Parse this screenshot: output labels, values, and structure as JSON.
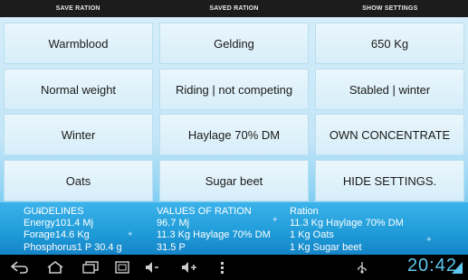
{
  "action_bar": {
    "save_ration": "SAVE RATION",
    "saved_ration": "SAVED RATION",
    "show_settings": "SHOW SETTINGS"
  },
  "grid": [
    [
      "Warmblood",
      "Gelding",
      "650 Kg"
    ],
    [
      "Normal weight",
      "Riding | not competing",
      "Stabled | winter"
    ],
    [
      "Winter",
      "Haylage 70% DM",
      "OWN CONCENTRATE"
    ],
    [
      "Oats",
      "Sugar beet",
      "HIDE SETTINGS."
    ]
  ],
  "info": {
    "guidelines": [
      "GUIDELINES",
      "Energy101.4 Mj",
      "Forage14.6 Kg",
      "Phosphorus1 P 30.4 g"
    ],
    "values": [
      "VALUES OF RATION",
      "96.7 Mj",
      "11.3 Kg Haylage 70% DM",
      "31.5 P"
    ],
    "ration": [
      "Ration",
      "11.3 Kg Haylage 70% DM",
      "1 Kg Oats",
      "1 Kg Sugar beet"
    ]
  },
  "system_bar": {
    "clock": "20:42",
    "icons": [
      "back-icon",
      "home-icon",
      "recent-apps-icon",
      "screenshot-icon",
      "volume-down-icon",
      "volume-up-icon",
      "menu-icon",
      "usb-icon",
      "signal-icon"
    ]
  },
  "colors": {
    "action_bar_bg": "#1c1c1c",
    "cell_bg": "#e3f3fb",
    "info_bg": "#2aa6e3",
    "clock": "#5ec8f0"
  }
}
